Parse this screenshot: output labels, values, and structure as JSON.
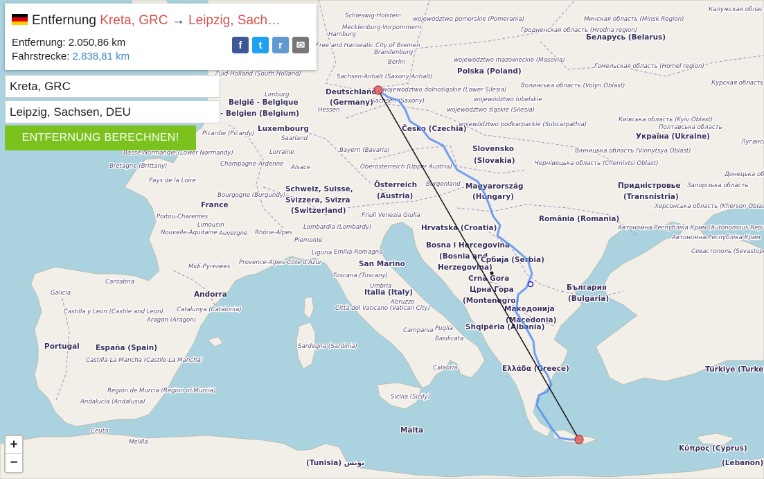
{
  "card": {
    "flag_colors": [
      "#000000",
      "#dd0000",
      "#ffce00"
    ],
    "title_prefix": "Entfernung",
    "from": "Kreta, GRC",
    "arrow": "→",
    "to": "Leipzig, Sach…",
    "distance_label": "Entfernung:",
    "distance_value": "2.050,86 km",
    "driving_label": "Fahrstrecke:",
    "driving_value": "2.838,81 km",
    "share": [
      {
        "icon": "facebook-icon",
        "glyph": "f",
        "color": "#3b5998"
      },
      {
        "icon": "twitter-icon",
        "glyph": "t",
        "color": "#1da1f2"
      },
      {
        "icon": "reddit-icon",
        "glyph": "r",
        "color": "#5f99cf"
      },
      {
        "icon": "email-icon",
        "glyph": "✉",
        "color": "#777777"
      }
    ]
  },
  "form": {
    "origin_value": "Kreta, GRC",
    "destination_value": "Leipzig, Sachsen, DEU",
    "calc_button": "ENTFERNUNG BERECHNEN!"
  },
  "zoom": {
    "in": "+",
    "out": "−"
  },
  "map": {
    "colors": {
      "sea": "#aad3df",
      "land": "#f2efe9",
      "route": "#5b8ff0",
      "line": "#111111",
      "marker": "#e06666"
    },
    "labels_major": [
      "Deutschland",
      "(Germany)",
      "Polska (Poland)",
      "Беларусь (Belarus)",
      "Česko (Czechia)",
      "Slovensko",
      "(Slovakia)",
      "Україна (Ukraine)",
      "Magyarország",
      "(Hungary)",
      "România (Romania)",
      "Österreich",
      "(Austria)",
      "Schweiz, Suisse,",
      "Svizzera, Svizra",
      "(Switzerland)",
      "France",
      "Luxembourg",
      "België - Belgique",
      "- Belgien (Belgium)",
      "Hrvatska (Croatia)",
      "Bosna i Hercegovina",
      "(Bosnia and",
      "Herzegovina)",
      "Србија (Serbia)",
      "Crna Gora",
      "Црна Гора",
      "(Montenegro)",
      "Македонија",
      "(Macedonia)",
      "Shqipëria (Albania)",
      "България",
      "(Bulgaria)",
      "Ελλάδα (Greece)",
      "Türkiye (Turkey)",
      "Italia (Italy)",
      "San Marino",
      "Andorra",
      "España (Spain)",
      "Portugal",
      "Malta",
      "Κύπρος (Cyprus)",
      "(Tunisia) تونس",
      "(Lebanon)",
      "Придністровье",
      "(Transnistria)"
    ],
    "labels_minor": [
      "Mecklenburg-Vorpommern",
      "Hamburg",
      "Brandenburg",
      "Berlin",
      "Sachsen-Anhalt (Saxony-Anhalt)",
      "Sachsen (Saxony)",
      "Hessen",
      "Bayern (Bavaria)",
      "Oberösterreich (Upper Austria)",
      "Burgenland",
      "województwo pomorskie (Pomerania)",
      "województwo mazowieckie (Masovia)",
      "województwo lubelskie",
      "województwo dolnośląskie (Lower Silesia)",
      "województwo śląskie (Silesia)",
      "województwo podkarpackie (Subcarpathia)",
      "Гродненская область (Hrodna region)",
      "Минская область (Minsk Region)",
      "Гомельская область (Homel region)",
      "Волинська область (Volyn Oblast)",
      "Київська область (Kyiv Oblast)",
      "Вінницька область (Vinnytsya Oblast)",
      "Чернівецька область (Chernivtsi Oblast)",
      "Полтавська область",
      "Донецька обл",
      "Запорізька область",
      "Херсонська область (Kherson Oblast)",
      "Автономна Республіка Крим (Autonomous Republic of Crimea)",
      "Севастополь (Sevastopol)",
      "Nord-Pas-de-Calais",
      "Picardie (Picardy)",
      "Basse-Normandie (Lower Normandy)",
      "Bretagne (Brittany)",
      "Pays de la Loire",
      "Champagne-Ardenne",
      "Lorraine",
      "Alsace",
      "Bourgogne (Burgundy)",
      "Franche-Comté",
      "Poitou-Charentes",
      "Limousin",
      "Nouvelle-Aquitaine",
      "Auvergne",
      "Rhône-Alpes",
      "Midi-Pyrénées",
      "Provence-Alpes-Côte d'Azur",
      "Lombardia (Lombardy)",
      "Piemonte",
      "Liguria",
      "Emilia-Romagna",
      "Toscana (Tuscany)",
      "Umbria",
      "Abruzzo",
      "Città del Vaticano (Vatican City)",
      "Campania",
      "Puglia",
      "Basilicata",
      "Calabria",
      "Sicilia (Sicily)",
      "Sardegna (Sardinia)",
      "Friuli Venezia Giulia",
      "Galicia",
      "Cantabria",
      "Castilla y León (Castile and León)",
      "Aragón (Aragon)",
      "Catalunya (Catalonia)",
      "Castilla-La Mancha (Castile-La Mancha)",
      "Región de Murcia (Region of Murcia)",
      "Andalucía (Andalusia)",
      "Ceuta",
      "Melilla",
      "Saarland",
      "Limburg",
      "Zuid-Holland (South Holland)",
      "Free and Hanseatic City of Bremen",
      "Schleswig-Holstein",
      "Калужская область",
      "Курская область",
      "Луганська"
    ]
  }
}
